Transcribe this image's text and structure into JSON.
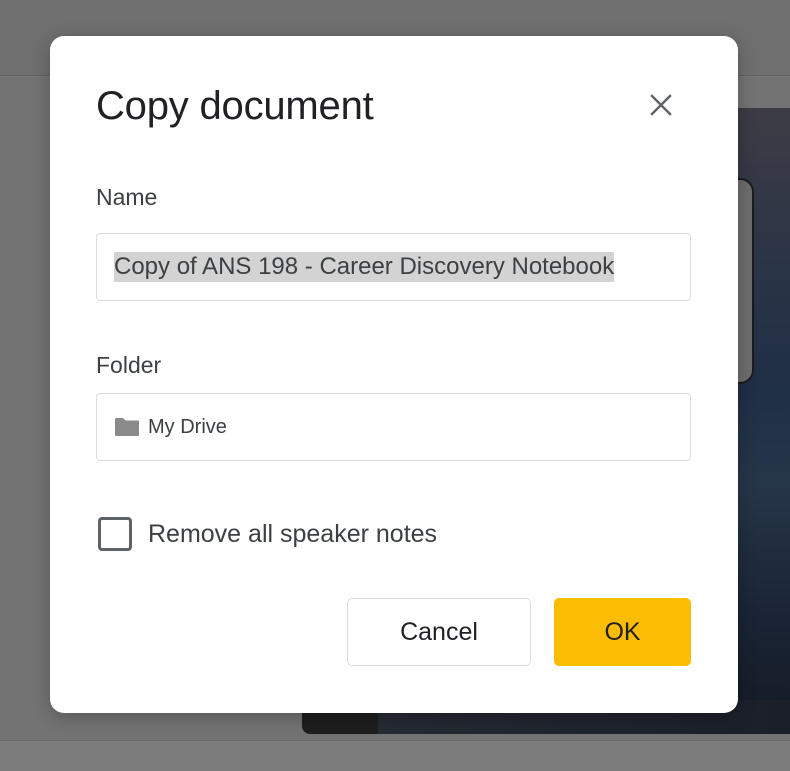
{
  "dialog": {
    "title": "Copy document",
    "close_icon": "close-icon",
    "name_label": "Name",
    "name_value": "Copy of ANS 198 - Career Discovery Notebook",
    "folder_label": "Folder",
    "folder_icon": "folder-icon",
    "folder_value": "My Drive",
    "checkbox_label": "Remove all speaker notes",
    "checkbox_checked": false,
    "cancel_label": "Cancel",
    "ok_label": "OK"
  },
  "colors": {
    "accent": "#fbbc04",
    "overlay": "#7a7a7a",
    "text": "#3c4043"
  }
}
